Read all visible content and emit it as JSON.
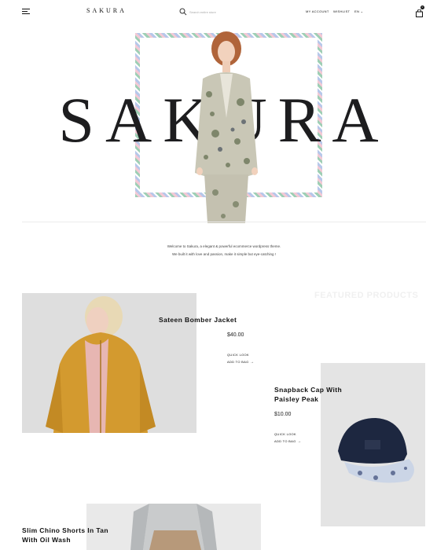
{
  "header": {
    "logo": "SAKURA",
    "search": {
      "placeholder": "Search entire store"
    },
    "nav": {
      "account": "MY ACCOUNT",
      "wishlist": "WISHLIST",
      "language": "EN"
    },
    "cart": {
      "count": "0"
    }
  },
  "hero": {
    "title": "SAKURA",
    "welcome_line1": "Welcome to Sakura, a elegant & powerful ecommerce wordpress theme.",
    "welcome_line2": "We built it with love and passion, make it simple but eye-catching !"
  },
  "featured": {
    "label": "FEATURED PRODUCTS",
    "products": [
      {
        "name": "Sateen Bomber Jacket",
        "price": "$40.00",
        "quick_look": "QUICK LOOK",
        "add_to_bag": "ADD TO BAG"
      },
      {
        "name_line1": "Snapback Cap With",
        "name_line2": "Paisley Peak",
        "price": "$10.00",
        "quick_look": "QUICK LOOK",
        "add_to_bag": "ADD TO BAG"
      },
      {
        "name_line1": "Slim Chino Shorts In Tan",
        "name_line2": "With Oil Wash"
      }
    ]
  },
  "colors": {
    "accent": "#111111",
    "background": "#ffffff",
    "jacket": "#d69a2c",
    "cap": "#1f2a44"
  }
}
